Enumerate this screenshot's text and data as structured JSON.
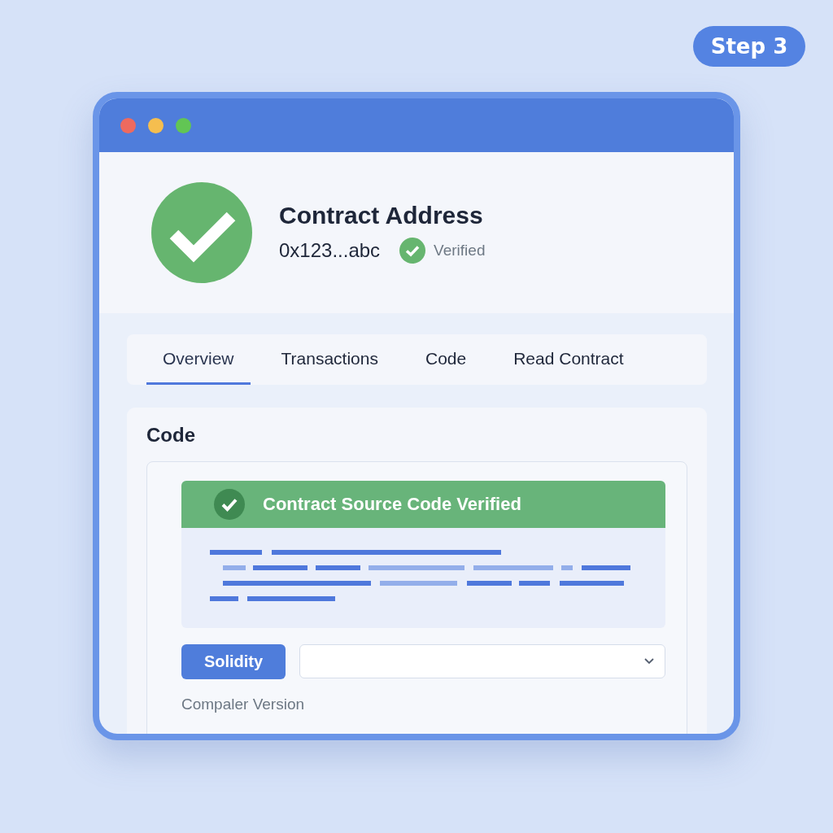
{
  "step_badge": "Step 3",
  "window": {
    "controls": [
      {
        "color": "#ee6a5f"
      },
      {
        "color": "#f5be4f"
      },
      {
        "color": "#62c554"
      }
    ]
  },
  "header": {
    "title": "Contract Address",
    "address": "0x123...abc",
    "status": {
      "verified": true,
      "label": "Verified"
    }
  },
  "tabs": [
    {
      "label": "Overview",
      "selected": true
    },
    {
      "label": "Transactions",
      "selected": false
    },
    {
      "label": "Code",
      "selected": false
    },
    {
      "label": "Read Contract",
      "selected": false
    }
  ],
  "code_section": {
    "title": "Code",
    "banner": {
      "verified": true,
      "text": "Contract Source Code Verified"
    },
    "language_button": "Solidity",
    "compiler_label": "Compaler Version"
  }
}
